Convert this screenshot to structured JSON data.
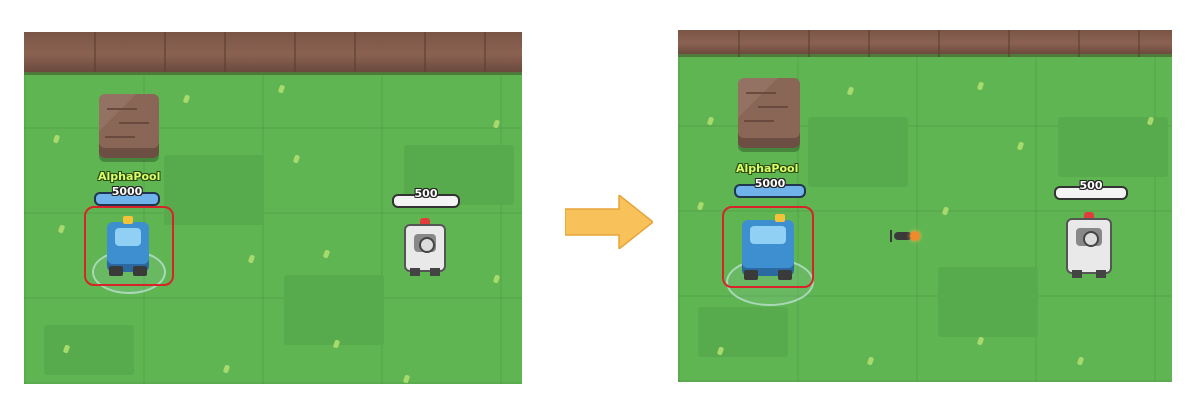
{
  "frames": [
    {
      "id": "before",
      "player": {
        "name": "AlphaPool",
        "hp": "5000"
      },
      "enemy": {
        "hp": "500"
      },
      "projectile_visible": false
    },
    {
      "id": "after",
      "player": {
        "name": "AlphaPool",
        "hp": "5000"
      },
      "enemy": {
        "hp": "500"
      },
      "projectile_visible": true
    }
  ],
  "colors": {
    "grass": "#5fb552",
    "wall": "#7a5546",
    "highlight": "#d8232a",
    "arrow": "#f9c15a",
    "player_hp": "#6fb3ea"
  },
  "icons": {
    "transition": "right-arrow-icon",
    "projectile": "rocket-icon"
  }
}
